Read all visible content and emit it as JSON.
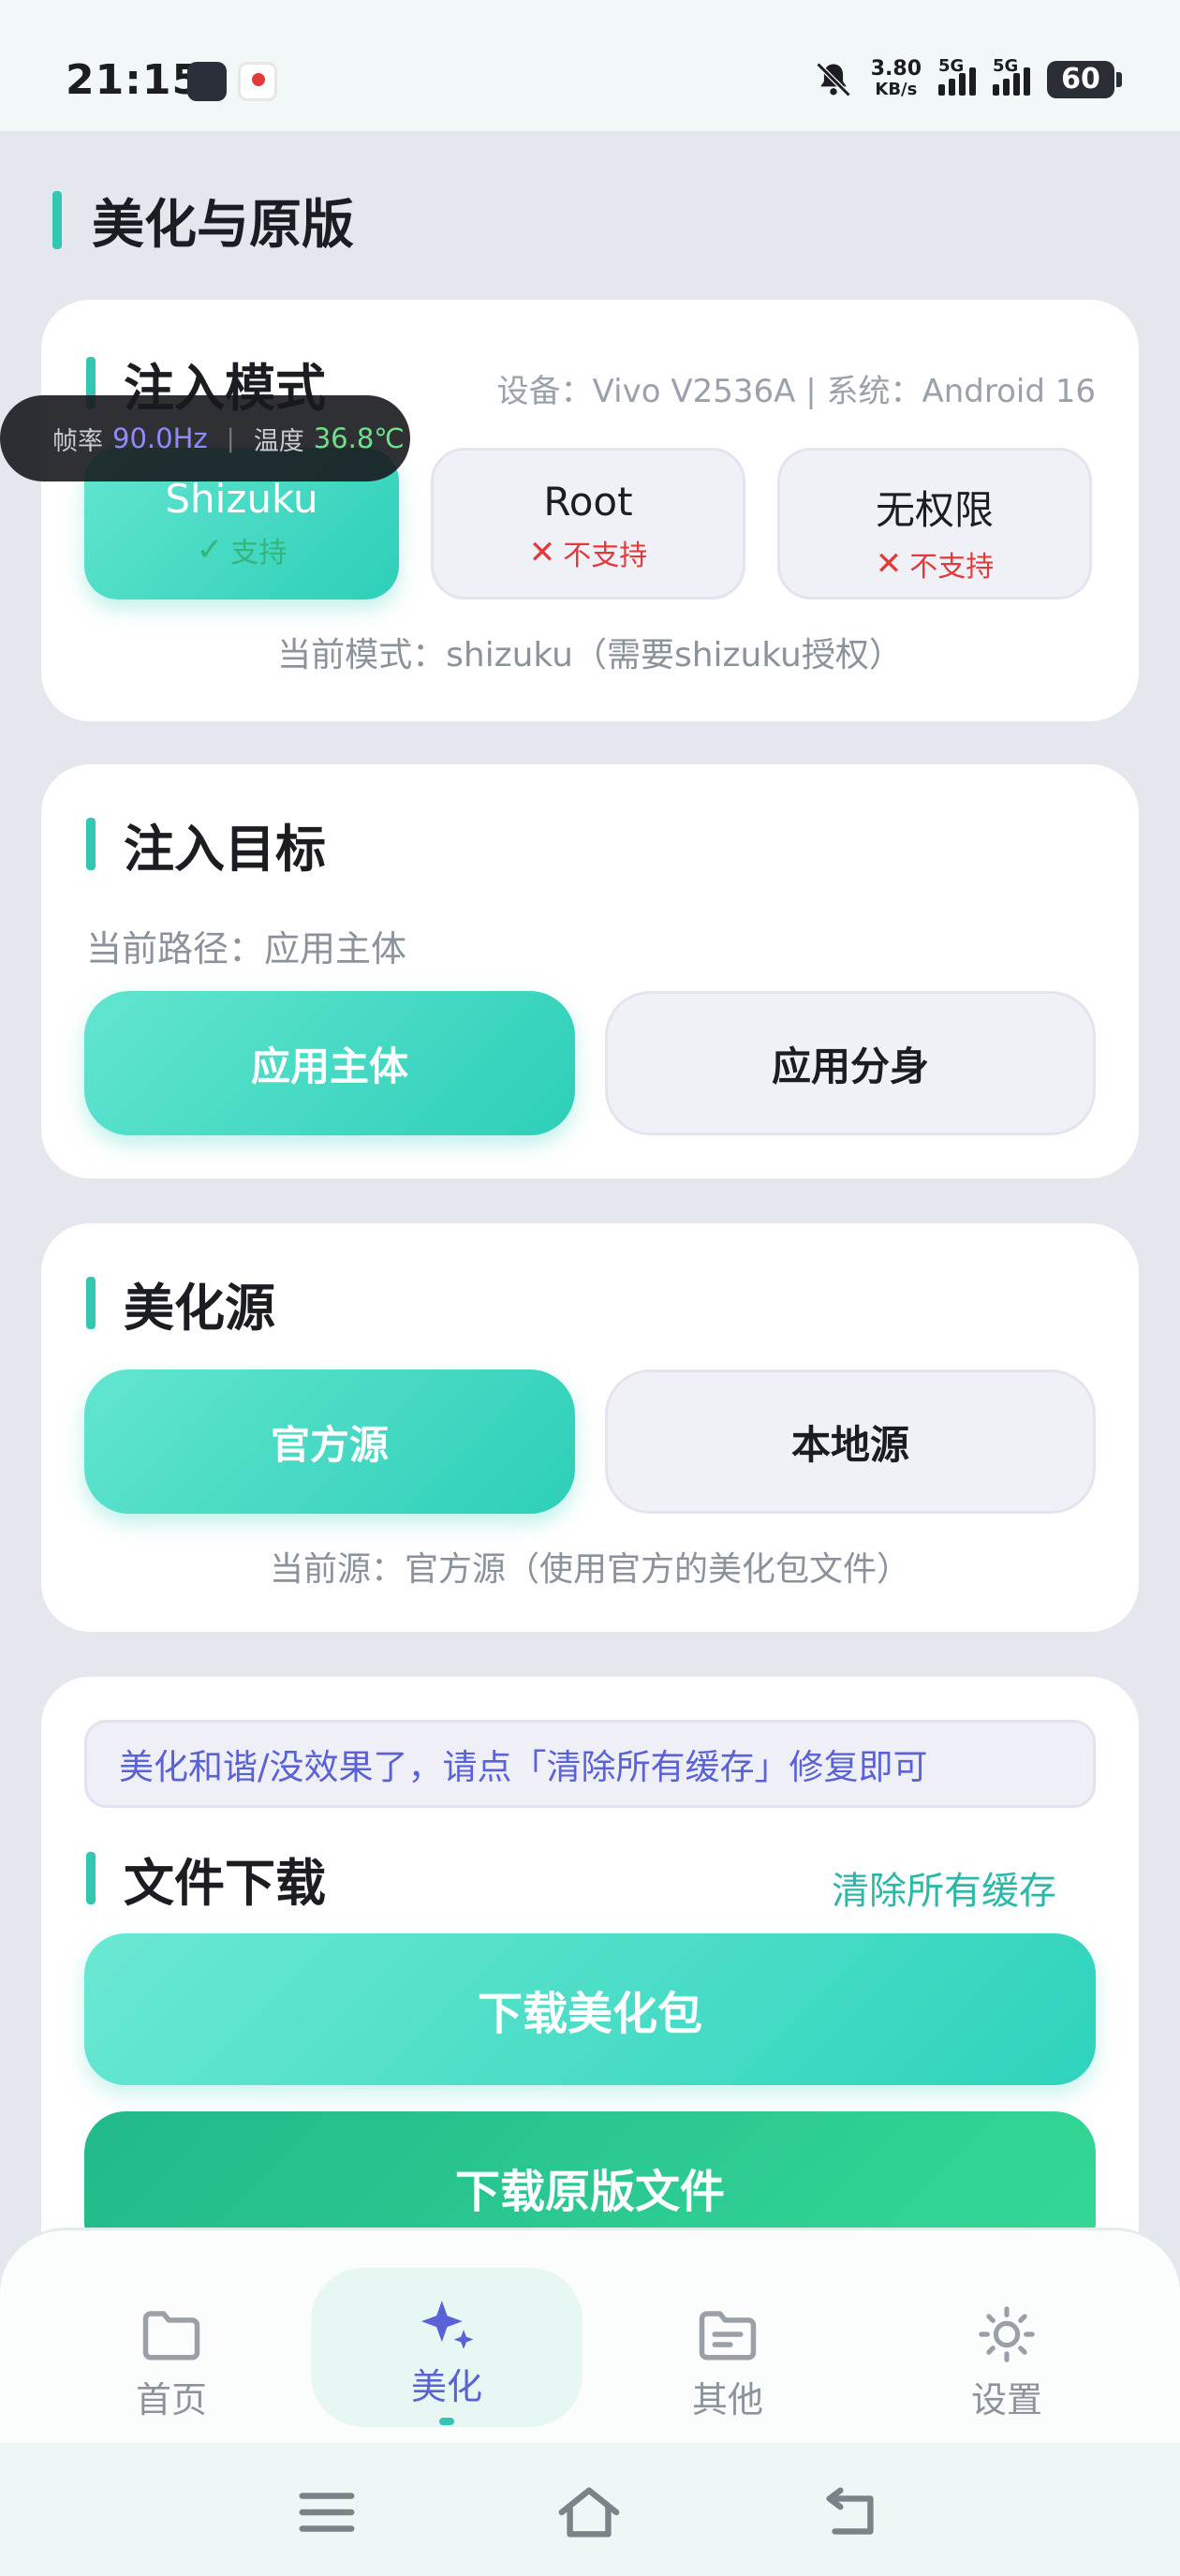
{
  "status_bar": {
    "time": "21:15",
    "speed_value": "3.80",
    "speed_unit": "KB/s",
    "sim1_label": "5G",
    "sim2_label": "5G",
    "battery": "60"
  },
  "page": {
    "title": "美化与原版"
  },
  "injection_mode": {
    "title": "注入模式",
    "device_info": "设备：Vivo V2536A | 系统：Android 16",
    "options": [
      {
        "name": "Shizuku",
        "status": "支持",
        "supported": true,
        "selected": true
      },
      {
        "name": "Root",
        "status": "不支持",
        "supported": false,
        "selected": false
      },
      {
        "name": "无权限",
        "status": "不支持",
        "supported": false,
        "selected": false
      }
    ],
    "current": "当前模式：shizuku（需要shizuku授权）"
  },
  "overlay": {
    "fps_label": "帧率",
    "fps_value": "90.0Hz",
    "temp_label": "温度",
    "temp_value": "36.8℃"
  },
  "injection_target": {
    "title": "注入目标",
    "current_path": "当前路径：应用主体",
    "options": [
      {
        "label": "应用主体",
        "selected": true
      },
      {
        "label": "应用分身",
        "selected": false
      }
    ]
  },
  "beautify_source": {
    "title": "美化源",
    "options": [
      {
        "label": "官方源",
        "selected": true
      },
      {
        "label": "本地源",
        "selected": false
      }
    ],
    "current": "当前源：官方源（使用官方的美化包文件）"
  },
  "file_download": {
    "hint": "美化和谐/没效果了，请点「清除所有缓存」修复即可",
    "title": "文件下载",
    "clear_cache": "清除所有缓存",
    "download_beautify": "下载美化包",
    "download_original": "下载原版文件"
  },
  "bottom_nav": {
    "items": [
      {
        "label": "首页",
        "icon": "folder-icon",
        "active": false
      },
      {
        "label": "美化",
        "icon": "sparkle-icon",
        "active": true
      },
      {
        "label": "其他",
        "icon": "file-folder-icon",
        "active": false
      },
      {
        "label": "设置",
        "icon": "sun-gear-icon",
        "active": false
      }
    ]
  },
  "colors": {
    "accent": "#33c6b0",
    "active_nav": "#5a62d6",
    "supported": "#36b57a",
    "unsupported": "#e23a3a"
  }
}
